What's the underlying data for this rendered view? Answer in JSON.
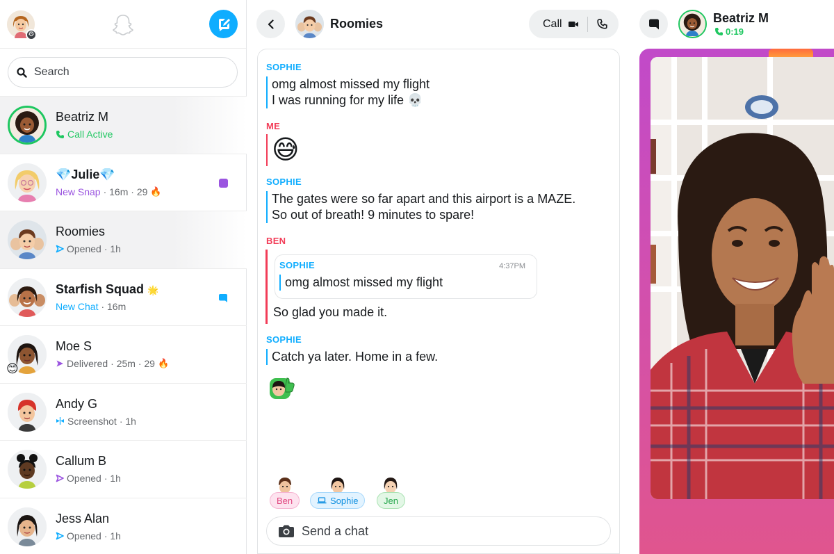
{
  "sidebar": {
    "search_placeholder": "Search",
    "conversations": [
      {
        "name": "Beatriz M",
        "status": "Call Active",
        "status_color": "#1ec760",
        "status_icon": "phone-icon",
        "selected": true
      },
      {
        "name": "💎Julie💎",
        "status": "New Snap",
        "meta": "· 16m · 29",
        "streak": "🔥",
        "status_color": "#9b55e0",
        "badge_color": "#9b55e0",
        "badge": "snap-square"
      },
      {
        "name": "Roomies",
        "status": "Opened",
        "meta": "· 1h",
        "status_icon": "sent-arrow-icon",
        "icon_color": "#0fadff",
        "selected_soft": true
      },
      {
        "name": "Starfish Squad",
        "name_emoji": "🌟",
        "status": "New Chat",
        "meta": "· 16m",
        "status_color": "#0fadff",
        "badge_color": "#0fadff",
        "badge": "chat-bubble"
      },
      {
        "name": "Moe S",
        "status": "Delivered",
        "meta": "· 25m · 29",
        "streak": "🔥",
        "status_icon": "sent-arrow-icon",
        "icon_color": "#9b55e0",
        "overlay_emoji": "😊"
      },
      {
        "name": "Andy G",
        "status": "Screenshot",
        "meta": "· 1h",
        "status_icon": "screenshot-icon",
        "icon_color": "#0fadff"
      },
      {
        "name": "Callum B",
        "status": "Opened",
        "meta": "· 1h",
        "status_icon": "opened-arrow-icon",
        "icon_color": "#9b55e0"
      },
      {
        "name": "Jess Alan",
        "status": "Opened",
        "meta": "· 1h",
        "status_icon": "opened-arrow-icon",
        "icon_color": "#0fadff"
      }
    ]
  },
  "chat": {
    "title": "Roomies",
    "call_label": "Call",
    "messages": [
      {
        "sender": "SOPHIE",
        "lines": [
          "omg almost missed my flight",
          "I was running for my life 💀"
        ]
      },
      {
        "sender": "ME",
        "emoji": "😅"
      },
      {
        "sender": "SOPHIE",
        "lines": [
          "The gates were so far apart and this airport is a MAZE.",
          "So out of breath! 9 minutes to spare!"
        ]
      },
      {
        "sender": "BEN",
        "quote": {
          "sender": "SOPHIE",
          "time": "4:37PM",
          "text": "omg almost missed my flight"
        },
        "text": "So glad you made it."
      },
      {
        "sender": "SOPHIE",
        "lines": [
          "Catch ya later. Home in a few."
        ]
      }
    ],
    "present": [
      {
        "name": "Ben",
        "chip_bg": "#fde3ef",
        "chip_border": "#f6b3d0",
        "text_color": "#e0457e"
      },
      {
        "name": "Sophie",
        "chip_bg": "#e2f3ff",
        "chip_border": "#a8d8fb",
        "text_color": "#0f8fe0",
        "icon": "laptop-icon"
      },
      {
        "name": "Jen",
        "chip_bg": "#e3f7e6",
        "chip_border": "#a9e2b2",
        "text_color": "#23a64a"
      }
    ],
    "input_placeholder": "Send a chat"
  },
  "call": {
    "name": "Beatriz M",
    "timer": "0:19"
  },
  "colors": {
    "brand_blue": "#0fadff",
    "me_red": "#f23c57",
    "call_green": "#1ec760",
    "snap_purple": "#9b55e0"
  }
}
